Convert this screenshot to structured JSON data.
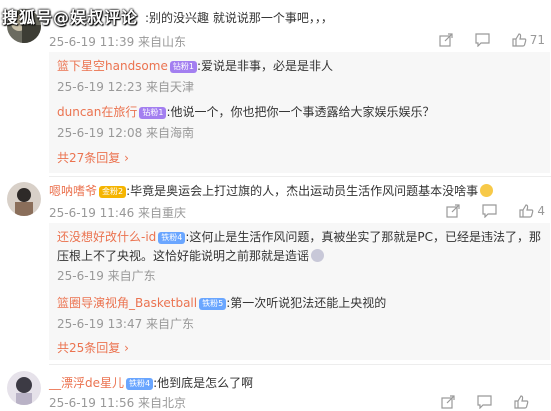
{
  "watermark": "搜狐号@娱叔评论",
  "c1": {
    "text": ":别的没兴趣 就说说那一个事吧，，，",
    "meta": "25-6-19 11:39 来自山东",
    "likes": "71",
    "replies": [
      {
        "user": "篮下星空handsome",
        "badge": "钻粉1",
        "text": ":爱说是非事，必是是非人",
        "meta": "25-6-19 12:23 来自天津"
      },
      {
        "user": "duncan在旅行",
        "badge": "钻粉1",
        "text": ":他说一个，你也把你一个事透露给大家娱乐娱乐？",
        "meta": "25-6-19 12:08 来自海南"
      }
    ],
    "more": "共27条回复"
  },
  "c2": {
    "user": "嗯呐嗜爷",
    "badge": "金粉2",
    "text": ":毕竟是奥运会上打过旗的人，杰出运动员生活作风问题基本没啥事",
    "meta": "25-6-19 11:46 来自重庆",
    "likes": "4",
    "replies": [
      {
        "user": "还没想好改什么-id",
        "badge": "铁粉4",
        "text1": ":这何止是生活作风问题，真被坐实了那就是PC，已经是违法了，那",
        "text2": "压根上不了央视。这恰好能说明之前那就是造谣",
        "meta": "25-6-19 来自广东"
      },
      {
        "user": "篮圈导演视角_Basketball",
        "badge": "铁粉5",
        "text": ":第一次听说犯法还能上央视的",
        "meta": "25-6-19 13:47 来自广东"
      }
    ],
    "more": "共25条回复"
  },
  "c3": {
    "user": "__漂浮de星儿",
    "badge": "铁粉4",
    "text": ":他到底是怎么了啊",
    "meta": "25-6-19 11:56 来自北京"
  },
  "colors": {
    "username": "#eb7350",
    "meta": "#999999",
    "reply_bg": "#f7f7f7"
  },
  "icons": [
    "share-icon",
    "comment-icon",
    "like-icon"
  ]
}
